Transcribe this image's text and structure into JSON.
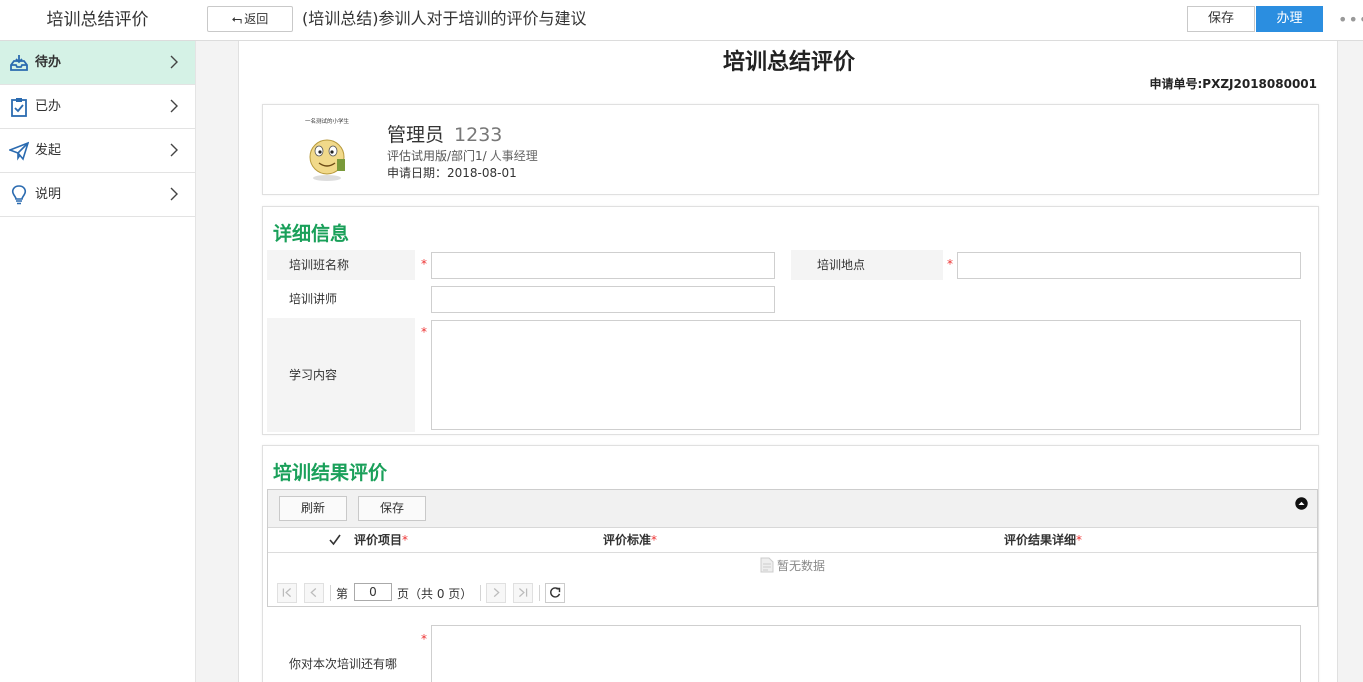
{
  "app": {
    "title": "培训总结评价"
  },
  "topbar": {
    "back_label": "返回",
    "doc_title": "(培训总结)参训人对于培训的评价与建议",
    "save_label": "保存",
    "handle_label": "办理",
    "more_label": "•••",
    "colors": {
      "primary": "#2b8ee0"
    }
  },
  "sidebar": {
    "items": [
      {
        "label": "待办",
        "icon": "inbox-icon",
        "active": true
      },
      {
        "label": "已办",
        "icon": "clipboard-check-icon"
      },
      {
        "label": "发起",
        "icon": "paper-plane-icon"
      },
      {
        "label": "说明",
        "icon": "lightbulb-icon"
      }
    ],
    "active_color": "#d5f2e6"
  },
  "form": {
    "heading": "培训总结评价",
    "number_label": "申请单号:",
    "number_value": "PXZJ2018080001"
  },
  "user": {
    "avatar_caption": "一名测试的小学生",
    "name": "管理员",
    "id": "1233",
    "dept_prefix": "评估试用版/部门1/",
    "dept_role": "人事经理",
    "date_label": "申请日期：",
    "date_value": "2018-08-01"
  },
  "detail": {
    "title": "详细信息",
    "title_color": "#1aa05a",
    "fields": {
      "class_name": {
        "label": "培训班名称",
        "required": "*",
        "value": ""
      },
      "location": {
        "label": "培训地点",
        "required": "*",
        "value": ""
      },
      "lecturer": {
        "label": "培训讲师",
        "value": ""
      },
      "content": {
        "label": "学习内容",
        "required": "*",
        "value": ""
      }
    }
  },
  "result": {
    "title": "培训结果评价",
    "toolbar": {
      "refresh_label": "刷新",
      "save_label": "保存"
    },
    "columns": [
      {
        "label": "评价项目",
        "required": "*"
      },
      {
        "label": "评价标准",
        "required": "*"
      },
      {
        "label": "评价结果详细",
        "required": "*"
      }
    ],
    "empty_text": "暂无数据",
    "pager": {
      "page_prefix": "第",
      "page_value": "0",
      "page_suffix": "页（共 0 页）"
    },
    "suggestion": {
      "label": "你对本次培训还有哪",
      "required": "*"
    }
  }
}
